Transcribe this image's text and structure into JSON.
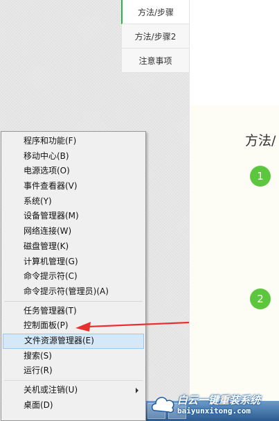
{
  "tabs": [
    {
      "label": "方法/步骤"
    },
    {
      "label": "方法/步骤2"
    },
    {
      "label": "注意事项"
    }
  ],
  "content": {
    "section_title": "方法/",
    "steps": [
      "1",
      "2"
    ]
  },
  "menu": {
    "group1": [
      {
        "label": "程序和功能(F)"
      },
      {
        "label": "移动中心(B)"
      },
      {
        "label": "电源选项(O)"
      },
      {
        "label": "事件查看器(V)"
      },
      {
        "label": "系统(Y)"
      },
      {
        "label": "设备管理器(M)"
      },
      {
        "label": "网络连接(W)"
      },
      {
        "label": "磁盘管理(K)"
      },
      {
        "label": "计算机管理(G)"
      },
      {
        "label": "命令提示符(C)"
      },
      {
        "label": "命令提示符(管理员)(A)"
      }
    ],
    "group2": [
      {
        "label": "任务管理器(T)"
      },
      {
        "label": "控制面板(P)"
      },
      {
        "label": "文件资源管理器(E)"
      },
      {
        "label": "搜索(S)"
      },
      {
        "label": "运行(R)"
      }
    ],
    "group3": [
      {
        "label": "关机或注销(U)"
      },
      {
        "label": "桌面(D)"
      }
    ],
    "highlight_color": "#d5e8f7"
  },
  "annotation": {
    "arrow_color": "#e8312f"
  },
  "watermark": {
    "brand": "白云一键重装系统",
    "url": "baiyunxitong.com"
  }
}
